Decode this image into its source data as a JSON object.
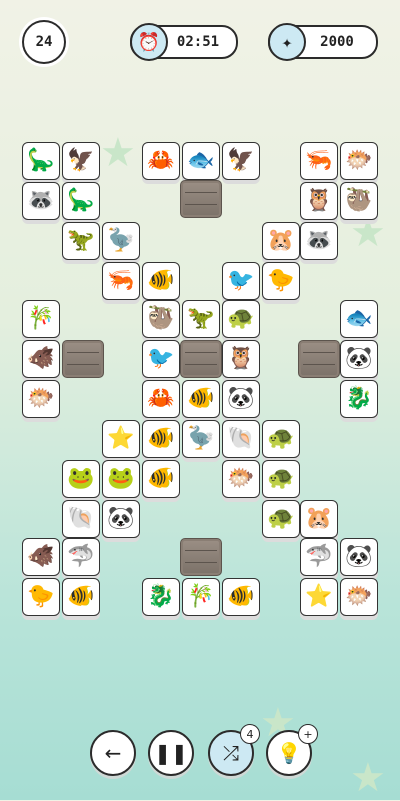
{
  "hud": {
    "level": "24",
    "timer": "02:51",
    "coins": "2000",
    "timer_icon": "alarm-clock-icon",
    "coins_icon": "sparkle-icon"
  },
  "controls": {
    "back_icon": "arrow-left-icon",
    "pause_icon": "pause-icon",
    "shuffle_icon": "shuffle-icon",
    "shuffle_count": "4",
    "hint_icon": "lightbulb-icon",
    "hint_badge": "+"
  },
  "board": {
    "tiles": [
      {
        "name": "dinosaur",
        "glyph": "🦕"
      },
      {
        "name": "vulture",
        "glyph": "🦅"
      },
      {
        "name": "crab",
        "glyph": "🦀"
      },
      {
        "name": "fish",
        "glyph": "🐟"
      },
      {
        "name": "vulture",
        "glyph": "🦅"
      },
      {
        "name": "shrimp",
        "glyph": "🦐"
      },
      {
        "name": "pufferfish",
        "glyph": "🐡"
      },
      {
        "name": "raccoon",
        "glyph": "🦝"
      },
      {
        "name": "dinosaur",
        "glyph": "🦕"
      },
      {
        "name": "owl",
        "glyph": "🦉"
      },
      {
        "name": "sloth",
        "glyph": "🦥"
      },
      {
        "name": "dinosaur",
        "glyph": "🦖"
      },
      {
        "name": "pterodactyl",
        "glyph": "🦤"
      },
      {
        "name": "hamster",
        "glyph": "🐹"
      },
      {
        "name": "raccoon",
        "glyph": "🦝"
      },
      {
        "name": "shrimp",
        "glyph": "🦐"
      },
      {
        "name": "goldfish",
        "glyph": "🐠"
      },
      {
        "name": "bird",
        "glyph": "🐦"
      },
      {
        "name": "chick",
        "glyph": "🐤"
      },
      {
        "name": "panda-bamboo",
        "glyph": "🎋"
      },
      {
        "name": "sloth",
        "glyph": "🦥"
      },
      {
        "name": "dinosaur",
        "glyph": "🦖"
      },
      {
        "name": "turtle",
        "glyph": "🐢"
      },
      {
        "name": "fish",
        "glyph": "🐟"
      },
      {
        "name": "boar",
        "glyph": "🐗"
      },
      {
        "name": "bird",
        "glyph": "🐦"
      },
      {
        "name": "owl",
        "glyph": "🦉"
      },
      {
        "name": "panda",
        "glyph": "🐼"
      },
      {
        "name": "pufferfish",
        "glyph": "🐡"
      },
      {
        "name": "crab",
        "glyph": "🦀"
      },
      {
        "name": "tropical-fish",
        "glyph": "🐠"
      },
      {
        "name": "panda",
        "glyph": "🐼"
      },
      {
        "name": "seahorse",
        "glyph": "🐉"
      },
      {
        "name": "starfish",
        "glyph": "⭐"
      },
      {
        "name": "clownfish",
        "glyph": "🐠"
      },
      {
        "name": "pterodactyl",
        "glyph": "🦤"
      },
      {
        "name": "seashell",
        "glyph": "🐚"
      },
      {
        "name": "turtle",
        "glyph": "🐢"
      },
      {
        "name": "frog",
        "glyph": "🐸"
      },
      {
        "name": "frog",
        "glyph": "🐸"
      },
      {
        "name": "goldfish",
        "glyph": "🐠"
      },
      {
        "name": "pufferfish",
        "glyph": "🐡"
      },
      {
        "name": "turtle",
        "glyph": "🐢"
      },
      {
        "name": "seashell",
        "glyph": "🐚"
      },
      {
        "name": "panda",
        "glyph": "🐼"
      },
      {
        "name": "turtle",
        "glyph": "🐢"
      },
      {
        "name": "hamster",
        "glyph": "🐹"
      },
      {
        "name": "boar",
        "glyph": "🐗"
      },
      {
        "name": "shark",
        "glyph": "🦈"
      },
      {
        "name": "shark",
        "glyph": "🦈"
      },
      {
        "name": "panda",
        "glyph": "🐼"
      },
      {
        "name": "chick",
        "glyph": "🐤"
      },
      {
        "name": "clownfish",
        "glyph": "🐠"
      },
      {
        "name": "seahorse",
        "glyph": "🐉"
      },
      {
        "name": "panda-bamboo",
        "glyph": "🎋"
      },
      {
        "name": "tropical-fish",
        "glyph": "🐠"
      },
      {
        "name": "starfish",
        "glyph": "⭐"
      },
      {
        "name": "pufferfish",
        "glyph": "🐡"
      }
    ]
  }
}
